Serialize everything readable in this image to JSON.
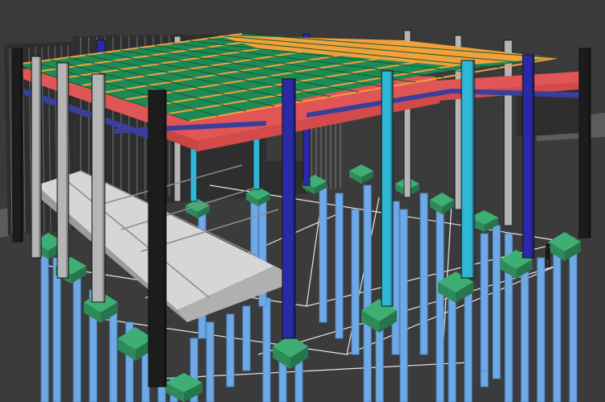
{
  "scene": {
    "subject": "",
    "colors": {
      "background": "#3a3a3a",
      "ground_slab": "#8a8a8a",
      "pile": "#6ea9e6",
      "pile_cap": "#2f8a5a",
      "column_black": "#1c1c1c",
      "column_grey": "#b5b5b5",
      "column_cyan": "#2fb7d6",
      "column_navy": "#2a2aa8",
      "beam_red": "#e05555",
      "roof_green": "#1d8a55",
      "roof_orange": "#f2a13a",
      "floor_slab": "#d9d9d9",
      "wall_mesh": "#2a2a2a",
      "person": "#1a1a1a"
    }
  }
}
